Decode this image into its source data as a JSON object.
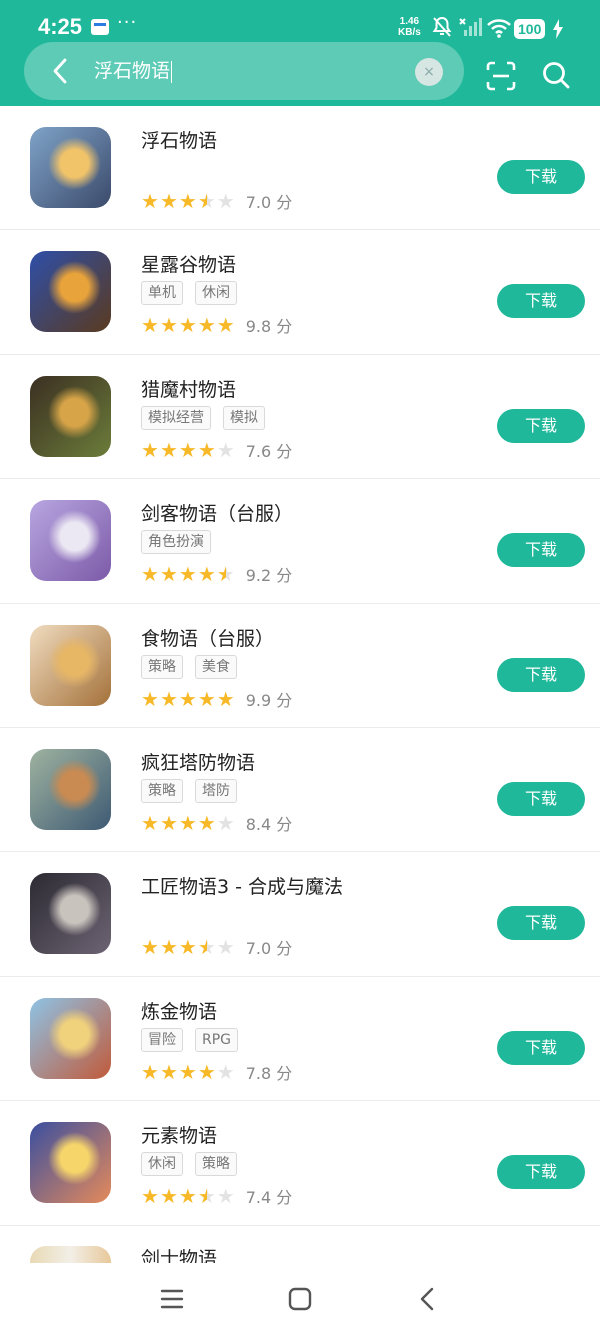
{
  "status_bar": {
    "time": "4:25",
    "more": "···",
    "net_speed_value": "1.46",
    "net_speed_unit": "KB/s",
    "battery": "100"
  },
  "search": {
    "query": "浮石物语",
    "clear_symbol": "×"
  },
  "apps": [
    {
      "title": "浮石物语",
      "tags": [],
      "rating": 3.5,
      "score": "7.0 分",
      "action": "下载",
      "icon_colors": [
        "#7fa3c8",
        "#f2c46a",
        "#3b4a6b"
      ]
    },
    {
      "title": "星露谷物语",
      "tags": [
        "单机",
        "休闲"
      ],
      "rating": 5,
      "score": "9.8 分",
      "action": "下载",
      "icon_colors": [
        "#2e4fa8",
        "#e8a33b",
        "#5a3a1f"
      ]
    },
    {
      "title": "猎魔村物语",
      "tags": [
        "模拟经营",
        "模拟"
      ],
      "rating": 4,
      "score": "7.6 分",
      "action": "下载",
      "icon_colors": [
        "#3b2f22",
        "#d7a448",
        "#6c7d3a"
      ]
    },
    {
      "title": "剑客物语（台服）",
      "tags": [
        "角色扮演"
      ],
      "rating": 4.5,
      "score": "9.2 分",
      "action": "下载",
      "icon_colors": [
        "#b8a6e0",
        "#ece8f3",
        "#7c5aa8"
      ]
    },
    {
      "title": "食物语（台服）",
      "tags": [
        "策略",
        "美食"
      ],
      "rating": 5,
      "score": "9.9 分",
      "action": "下载",
      "icon_colors": [
        "#f0dcc0",
        "#e7b766",
        "#a4713a"
      ]
    },
    {
      "title": "疯狂塔防物语",
      "tags": [
        "策略",
        "塔防"
      ],
      "rating": 4,
      "score": "8.4 分",
      "action": "下载",
      "icon_colors": [
        "#9fb3a0",
        "#c98b52",
        "#3e5a73"
      ]
    },
    {
      "title": "工匠物语3 - 合成与魔法",
      "tags": [],
      "rating": 3.5,
      "score": "7.0 分",
      "action": "下载",
      "icon_colors": [
        "#2c2a33",
        "#c9c3bd",
        "#6d6473"
      ]
    },
    {
      "title": "炼金物语",
      "tags": [
        "冒险",
        "RPG"
      ],
      "rating": 4,
      "score": "7.8 分",
      "action": "下载",
      "icon_colors": [
        "#8ec3e6",
        "#f1d27c",
        "#c15a3a"
      ]
    },
    {
      "title": "元素物语",
      "tags": [
        "休闲",
        "策略"
      ],
      "rating": 3.5,
      "score": "7.4 分",
      "action": "下载",
      "icon_colors": [
        "#3a4fa0",
        "#f6d56b",
        "#e58a5a"
      ]
    }
  ],
  "partial_app": {
    "title": "剑士物语"
  }
}
